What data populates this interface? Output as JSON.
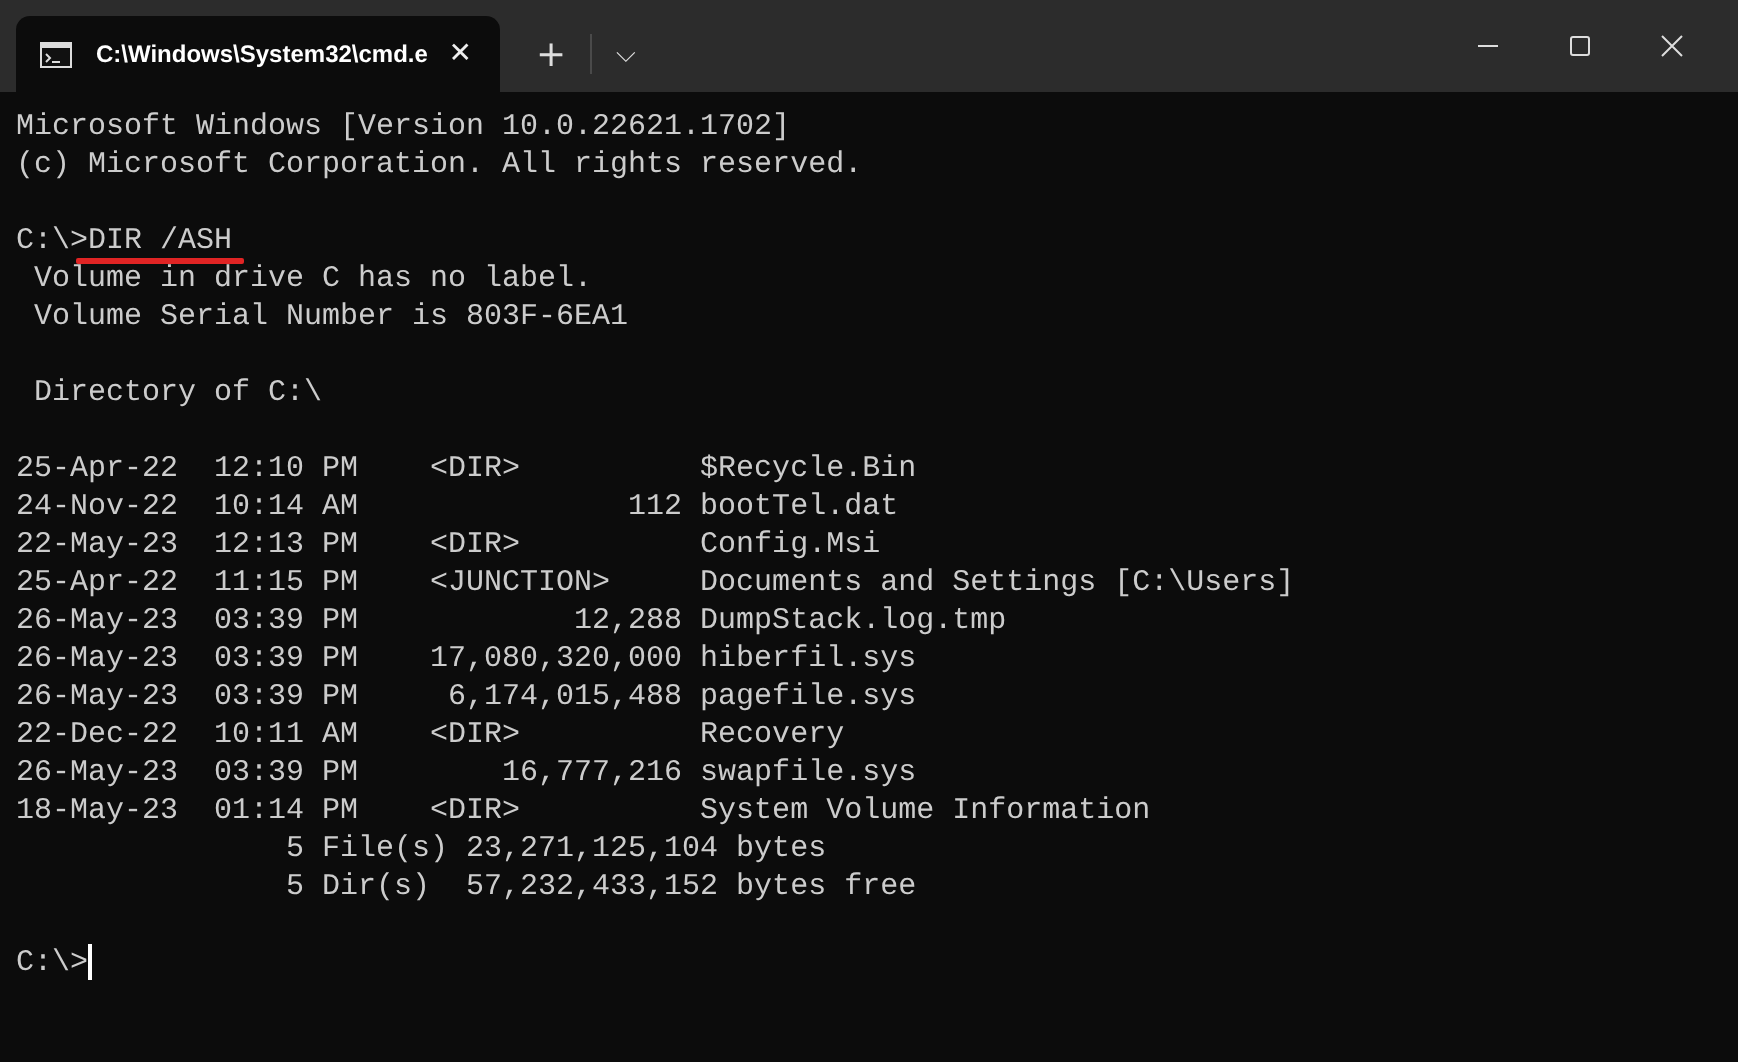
{
  "tab": {
    "title": "C:\\Windows\\System32\\cmd.e",
    "selected": true,
    "close": "✕"
  },
  "toolbar": {
    "new_tab": "+",
    "dropdown": "⌵"
  },
  "lines": [
    {
      "kind": "text",
      "text": "Microsoft Windows [Version 10.0.22621.1702]"
    },
    {
      "kind": "text",
      "text": "(c) Microsoft Corporation. All rights reserved."
    },
    {
      "kind": "blank"
    },
    {
      "kind": "command",
      "prompt": "C:\\>",
      "command": "DIR /ASH",
      "underlined": true
    },
    {
      "kind": "text",
      "text": " Volume in drive C has no label."
    },
    {
      "kind": "text",
      "text": " Volume Serial Number is 803F-6EA1"
    },
    {
      "kind": "blank"
    },
    {
      "kind": "text",
      "text": " Directory of C:\\"
    },
    {
      "kind": "blank"
    },
    {
      "kind": "text",
      "text": "25-Apr-22  12:10 PM    <DIR>          $Recycle.Bin"
    },
    {
      "kind": "text",
      "text": "24-Nov-22  10:14 AM               112 bootTel.dat"
    },
    {
      "kind": "text",
      "text": "22-May-23  12:13 PM    <DIR>          Config.Msi"
    },
    {
      "kind": "text",
      "text": "25-Apr-22  11:15 PM    <JUNCTION>     Documents and Settings [C:\\Users]"
    },
    {
      "kind": "text",
      "text": "26-May-23  03:39 PM            12,288 DumpStack.log.tmp"
    },
    {
      "kind": "text",
      "text": "26-May-23  03:39 PM    17,080,320,000 hiberfil.sys"
    },
    {
      "kind": "text",
      "text": "26-May-23  03:39 PM     6,174,015,488 pagefile.sys"
    },
    {
      "kind": "text",
      "text": "22-Dec-22  10:11 AM    <DIR>          Recovery"
    },
    {
      "kind": "text",
      "text": "26-May-23  03:39 PM        16,777,216 swapfile.sys"
    },
    {
      "kind": "text",
      "text": "18-May-23  01:14 PM    <DIR>          System Volume Information"
    },
    {
      "kind": "text",
      "text": "               5 File(s) 23,271,125,104 bytes"
    },
    {
      "kind": "text",
      "text": "               5 Dir(s)  57,232,433,152 bytes free"
    },
    {
      "kind": "blank"
    },
    {
      "kind": "prompt",
      "prompt": "C:\\>",
      "cursor": true
    }
  ]
}
